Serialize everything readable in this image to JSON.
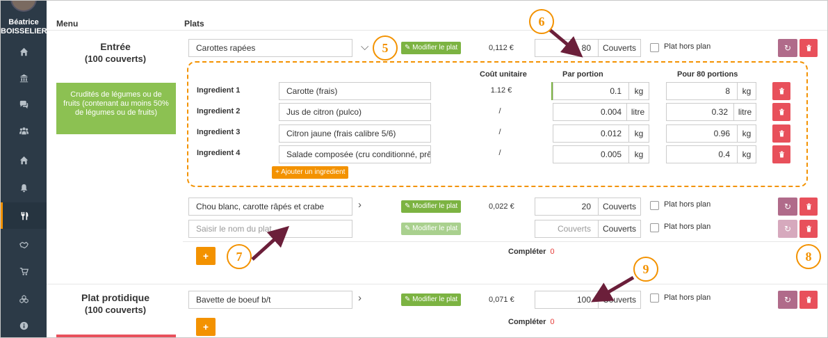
{
  "user": {
    "first_name": "Béatrice",
    "last_name": "BOISSELIER"
  },
  "sidebar": {
    "items": [
      {
        "icon": "home-icon",
        "glyph": "⌂"
      },
      {
        "icon": "bank-icon",
        "glyph": "🏛"
      },
      {
        "icon": "chat-icon",
        "glyph": "💬"
      },
      {
        "icon": "users-icon",
        "glyph": "👥"
      },
      {
        "icon": "home-alt-icon",
        "glyph": "⌂"
      },
      {
        "icon": "bell-icon",
        "glyph": "🔔"
      },
      {
        "icon": "cutlery-icon",
        "glyph": "🍴",
        "active": true
      },
      {
        "icon": "handshake-icon",
        "glyph": "🤝"
      },
      {
        "icon": "cart-icon",
        "glyph": "🛒"
      },
      {
        "icon": "cubes-icon",
        "glyph": "⬡"
      },
      {
        "icon": "info-icon",
        "glyph": "ℹ"
      }
    ]
  },
  "headers": {
    "menu": "Menu",
    "plats": "Plats"
  },
  "sections": {
    "entree": {
      "title": "Entrée",
      "subtitle": "(100 couverts)",
      "description": "Crudités de légumes ou de fruits (contenant au moins 50% de légumes ou de fruits)"
    },
    "plat": {
      "title": "Plat protidique",
      "subtitle": "(100 couverts)"
    }
  },
  "dishes": {
    "d1": {
      "name": "Carottes rapées",
      "price": "0,112 €",
      "couverts": "80"
    },
    "d2": {
      "name": "Chou blanc, carotte râpés et crabe",
      "price": "0,022 €",
      "couverts": "20"
    },
    "d3": {
      "placeholder": "Saisir le nom du plat",
      "couverts_placeholder": "Couverts"
    },
    "d4": {
      "name": "Bavette de boeuf b/t",
      "price": "0,071 €",
      "couverts": "100"
    }
  },
  "labels": {
    "modify": "Modifier le plat",
    "couverts": "Couverts",
    "hors_plan": "Plat hors plan",
    "add_ingredient": "+ Ajouter un ingredient",
    "completer": "Compléter",
    "completer_count": "0",
    "plus": "+"
  },
  "ingredients_table": {
    "col_cost": "Coût unitaire",
    "col_portion": "Par portion",
    "col_total": "Pour 80 portions",
    "rows": [
      {
        "label": "Ingredient 1",
        "name": "Carotte (frais)",
        "cost": "1.12 €",
        "portion": "0.1",
        "portion_unit": "kg",
        "total": "8",
        "total_unit": "kg"
      },
      {
        "label": "Ingredient 2",
        "name": "Jus de citron (pulco)",
        "cost": "/",
        "portion": "0.004",
        "portion_unit": "litre",
        "total": "0.32",
        "total_unit": "litre"
      },
      {
        "label": "Ingredient 3",
        "name": "Citron jaune (frais calibre 5/6)",
        "cost": "/",
        "portion": "0.012",
        "portion_unit": "kg",
        "total": "0.96",
        "total_unit": "kg"
      },
      {
        "label": "Ingredient 4",
        "name": "Salade composée (cru conditionné, prêt à",
        "cost": "/",
        "portion": "0.005",
        "portion_unit": "kg",
        "total": "0.4",
        "total_unit": "kg"
      }
    ]
  },
  "callouts": {
    "c5": "5",
    "c6": "6",
    "c7": "7",
    "c8": "8",
    "c9": "9"
  },
  "colors": {
    "accent": "#f39200",
    "green": "#7cb342",
    "danger": "#e8505b",
    "sidebar": "#2c3a47",
    "arrow": "#6b1f3a"
  }
}
